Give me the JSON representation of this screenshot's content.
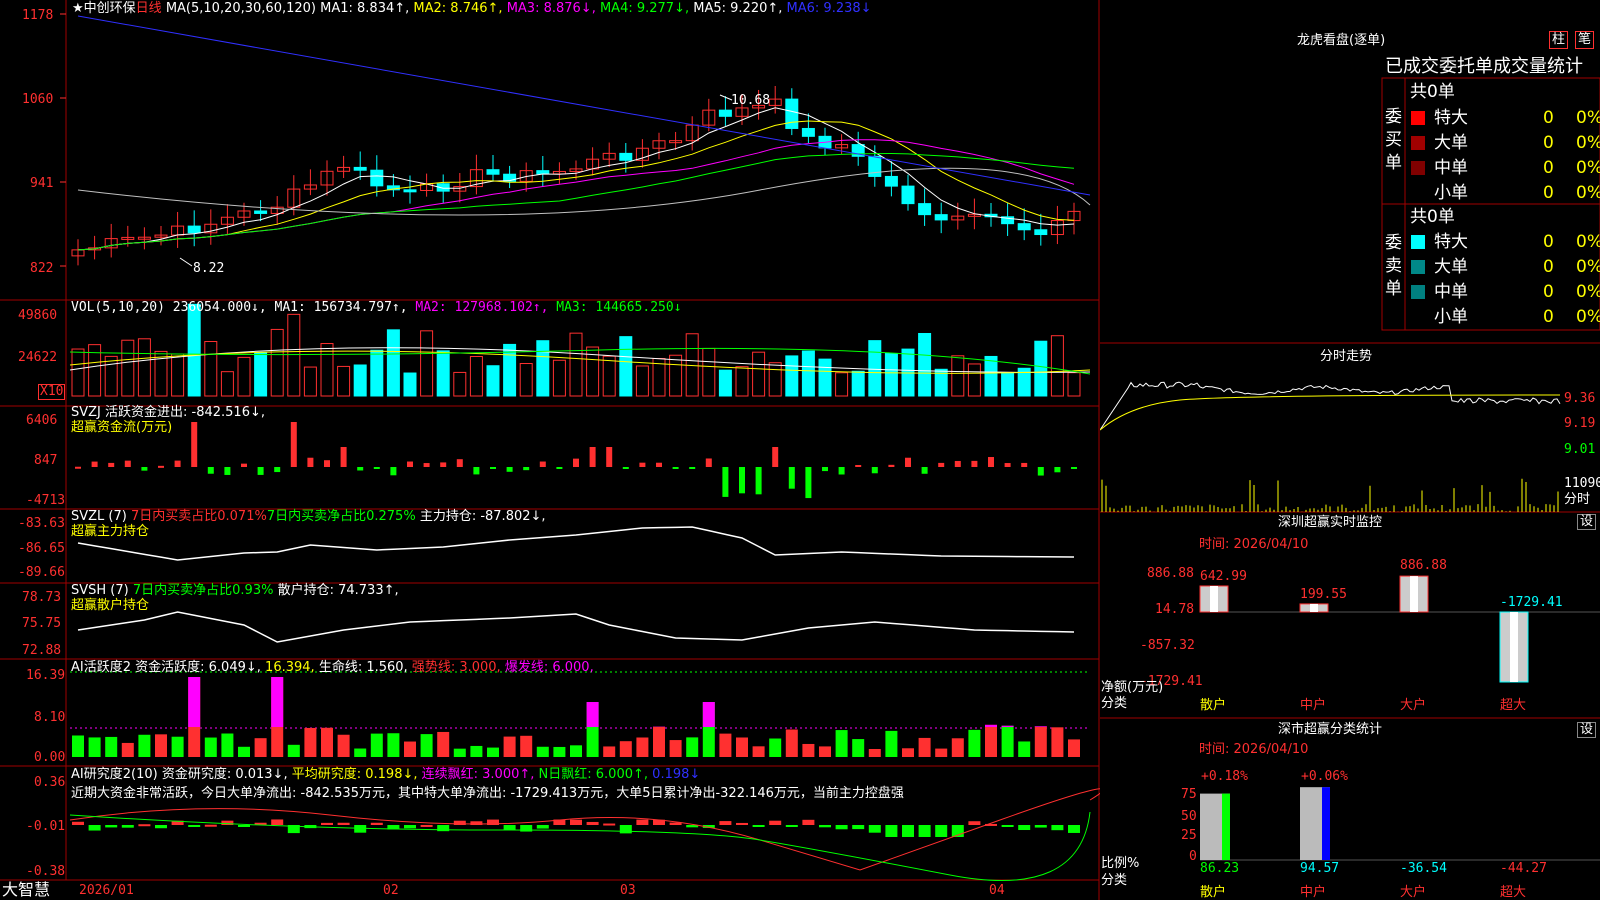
{
  "colors": {
    "red": "#ff3030",
    "cyan": "#00ffff",
    "white": "#ffffff",
    "yellow": "#ffff00",
    "magenta": "#ff00ff",
    "green": "#00ff00",
    "blue": "#0000ff",
    "gray": "#c0c0c0",
    "frame": "#a00000"
  },
  "header": {
    "star_name": "★中创环保",
    "period": "日线",
    "ma_label": "MA(5,10,20,30,60,120)",
    "ma1": "MA1: 8.834↑,",
    "ma2": "MA2: 8.746↑,",
    "ma3": "MA3: 8.876↓,",
    "ma4": "MA4: 9.277↓,",
    "ma5": "MA5: 9.220↑,",
    "ma6": "MA6: 9.238↓"
  },
  "price_axis": [
    "1178",
    "1060",
    "941",
    "822"
  ],
  "price_annot": {
    "high": "10.68",
    "low": "8.22"
  },
  "vol": {
    "label": "VOL(5,10,20)",
    "value": "236054.000↓,",
    "ma1": "MA1: 156734.797↑,",
    "ma2": "MA2: 127968.102↑,",
    "ma3": "MA3: 144665.250↓",
    "axis": [
      "49860",
      "24622"
    ],
    "unit": "X10"
  },
  "svzj": {
    "label": "SVZJ  活跃资金进出: -842.516↓,",
    "sub": "超赢资金流(万元)",
    "axis": [
      "6406",
      "847",
      "-4713"
    ]
  },
  "svzl": {
    "label": "SVZL (7)",
    "t1": "7日内买卖占比0.071%",
    "t2": "7日内买卖净占比0.275%",
    "t3": "主力持仓: -87.802↓,",
    "sub": "超赢主力持仓",
    "axis": [
      "-83.63",
      "-86.65",
      "-89.66"
    ]
  },
  "svsh": {
    "label": "SVSH (7)",
    "t1": "7日内买卖净占比0.93%",
    "t2": "散户持仓: 74.733↑,",
    "sub": "超赢散户持仓",
    "axis": [
      "78.73",
      "75.75",
      "72.88"
    ]
  },
  "ai1": {
    "label": "AI活跃度2",
    "t1": "资金活跃度: 6.049↓,",
    "t2": "16.394,",
    "t3": "生命线: 1.560,",
    "t4": "强势线: 3.000,",
    "t5": "爆发线: 6.000,",
    "axis": [
      "16.39",
      "8.10",
      "0.00"
    ]
  },
  "ai2": {
    "label": "AI研究度2(10)",
    "t1": "资金研究度: 0.013↓,",
    "t2": "平均研究度: 0.198↓,",
    "t3": "连续飘红: 3.000↑,",
    "t4": "N日飘红: 6.000↑,",
    "t5": "0.198↓",
    "comment": "近期大资金非常活跃，今日大单净流出: -842.535万元，其中特大单净流出: -1729.413万元，大单5日累计净出-322.146万元，当前主力控盘强",
    "axis": [
      "0.36",
      "-0.01",
      "-0.38"
    ]
  },
  "xaxis": {
    "brand": "大智慧",
    "dates": [
      "2026/01",
      "02",
      "03",
      "04"
    ]
  },
  "panel1": {
    "title": "龙虎看盘(逐单)",
    "btn1": "柱",
    "btn2": "笔",
    "subtitle": "已成交委托单成交量统计",
    "buy_side": "委买单",
    "sell_side": "委卖单",
    "buy_total": "共0单",
    "sell_total": "共0单",
    "buy_rows": [
      {
        "name": "特大",
        "val": "0",
        "pct": "0%"
      },
      {
        "name": "大单",
        "val": "0",
        "pct": "0%"
      },
      {
        "name": "中单",
        "val": "0",
        "pct": "0%"
      },
      {
        "name": "小单",
        "val": "0",
        "pct": "0%"
      }
    ],
    "sell_rows": [
      {
        "name": "特大",
        "val": "0",
        "pct": "0%"
      },
      {
        "name": "大单",
        "val": "0",
        "pct": "0%"
      },
      {
        "name": "中单",
        "val": "0",
        "pct": "0%"
      },
      {
        "name": "小单",
        "val": "0",
        "pct": "0%"
      }
    ]
  },
  "panel2": {
    "title": "分时走势",
    "axis": [
      "9.36",
      "9.19",
      "9.01"
    ],
    "vol_label": "11090",
    "vol_unit": "分时"
  },
  "panel3": {
    "title": "深圳超赢实时监控",
    "btn": "设",
    "time": "时间: 2026/04/10",
    "axis": [
      "886.88",
      "14.78",
      "-857.32",
      "-1729.41"
    ],
    "ylabel1": "净额(万元)",
    "ylabel2": "分类",
    "cats": [
      "散户",
      "中户",
      "大户",
      "超大"
    ],
    "values": [
      "642.99",
      "199.55",
      "886.88",
      "-1729.41"
    ]
  },
  "panel4": {
    "title": "深市超赢分类统计",
    "btn": "设",
    "time": "时间: 2026/04/10",
    "axis": [
      "75",
      "50",
      "25",
      "0"
    ],
    "ylabel1": "比例%",
    "ylabel2": "分类",
    "cats": [
      "散户",
      "中户",
      "大户",
      "超大"
    ],
    "top": [
      "+0.18%",
      "+0.06%"
    ],
    "values": [
      "86.23",
      "94.57",
      "-36.54",
      "-44.27"
    ]
  }
}
